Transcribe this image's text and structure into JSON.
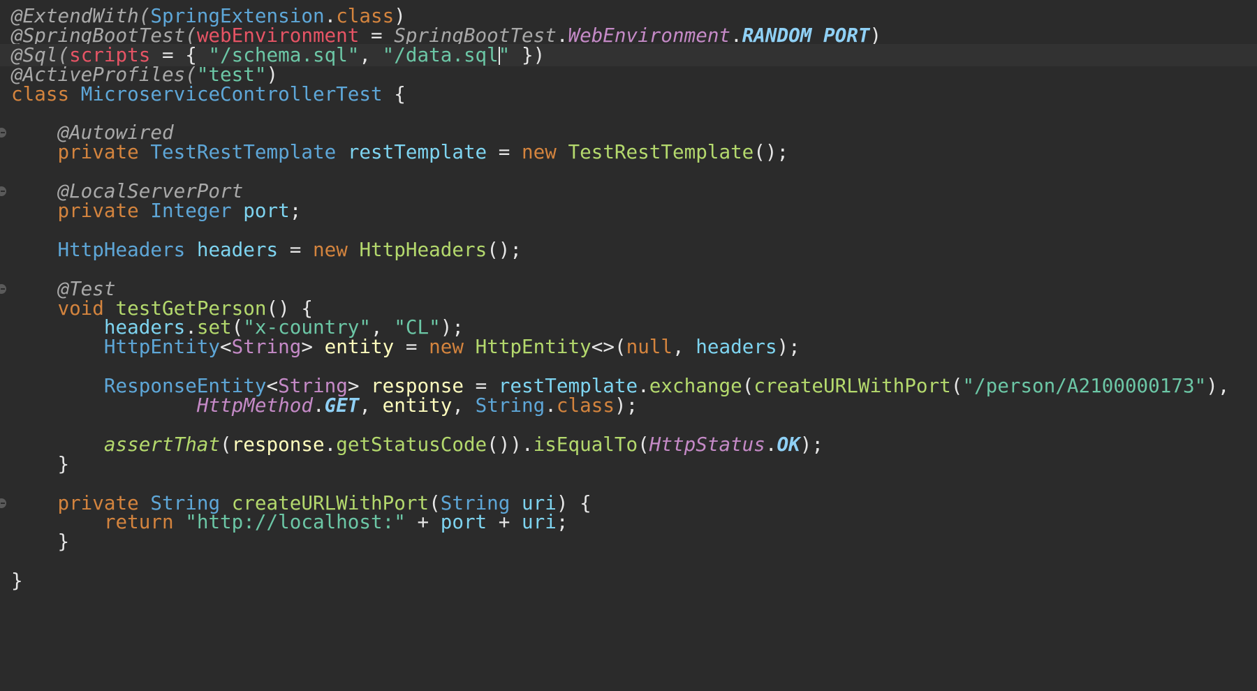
{
  "editor": {
    "language": "java",
    "current_line": 3,
    "theme": {
      "background": "#2b2b2b",
      "current_line_background": "#323232",
      "annotation": "#a9a9a9",
      "keyword": "#d4843e",
      "type": "#5ea7d8",
      "field": "#7ed4f0",
      "variable": "#fffdbe",
      "method": "#b4d96d",
      "string": "#6cc7a6",
      "param_name": "#e65465",
      "enum_type": "#c58ac7",
      "constant": "#8fd0f5",
      "default_text": "#e6e6e6",
      "fold_marker": "#5a5a5a"
    },
    "lines": [
      {
        "n": 1,
        "tokens": [
          [
            "@ExtendWith(",
            "annotation",
            "i"
          ],
          [
            "SpringExtension",
            "type"
          ],
          [
            ".",
            "default_text"
          ],
          [
            "class",
            "keyword"
          ],
          [
            ")",
            "default_text"
          ]
        ]
      },
      {
        "n": 2,
        "tokens": [
          [
            "@SpringBootTest(",
            "annotation",
            "i"
          ],
          [
            "webEnvironment",
            "param_name"
          ],
          [
            " = ",
            "default_text"
          ],
          [
            "SpringBootTest",
            "annotation",
            "i"
          ],
          [
            ".",
            "default_text"
          ],
          [
            "WebEnvironment",
            "enum_type",
            "i"
          ],
          [
            ".",
            "default_text"
          ],
          [
            "RANDOM_PORT",
            "constant",
            "ib"
          ],
          [
            ")",
            "default_text"
          ]
        ]
      },
      {
        "n": 3,
        "current": true,
        "tokens": [
          [
            "@Sql(",
            "annotation",
            "i"
          ],
          [
            "scripts",
            "param_name"
          ],
          [
            " = { ",
            "default_text"
          ],
          [
            "\"/schema.sql\"",
            "string"
          ],
          [
            ", ",
            "default_text"
          ],
          [
            "\"/data.sql",
            "string"
          ],
          [
            "|caret|",
            "caret"
          ],
          [
            "\"",
            "string"
          ],
          [
            " })",
            "default_text"
          ]
        ]
      },
      {
        "n": 4,
        "tokens": [
          [
            "@ActiveProfiles(",
            "annotation",
            "i"
          ],
          [
            "\"test\"",
            "string"
          ],
          [
            ")",
            "default_text"
          ]
        ]
      },
      {
        "n": 5,
        "tokens": [
          [
            "class",
            "keyword"
          ],
          [
            " ",
            "default_text"
          ],
          [
            "MicroserviceControllerTest",
            "type"
          ],
          [
            " {",
            "default_text"
          ]
        ]
      },
      {
        "n": 6,
        "tokens": []
      },
      {
        "n": 7,
        "fold": true,
        "tokens": [
          [
            "    ",
            "default_text"
          ],
          [
            "@Autowired",
            "annotation",
            "i"
          ]
        ]
      },
      {
        "n": 8,
        "tokens": [
          [
            "    ",
            "default_text"
          ],
          [
            "private",
            "keyword"
          ],
          [
            " ",
            "default_text"
          ],
          [
            "TestRestTemplate",
            "type"
          ],
          [
            " ",
            "default_text"
          ],
          [
            "restTemplate",
            "field"
          ],
          [
            " = ",
            "default_text"
          ],
          [
            "new",
            "keyword"
          ],
          [
            " ",
            "default_text"
          ],
          [
            "TestRestTemplate",
            "method"
          ],
          [
            "();",
            "default_text"
          ]
        ]
      },
      {
        "n": 9,
        "tokens": []
      },
      {
        "n": 10,
        "fold": true,
        "tokens": [
          [
            "    ",
            "default_text"
          ],
          [
            "@LocalServerPort",
            "annotation",
            "i"
          ]
        ]
      },
      {
        "n": 11,
        "tokens": [
          [
            "    ",
            "default_text"
          ],
          [
            "private",
            "keyword"
          ],
          [
            " ",
            "default_text"
          ],
          [
            "Integer",
            "type"
          ],
          [
            " ",
            "default_text"
          ],
          [
            "port",
            "field"
          ],
          [
            ";",
            "default_text"
          ]
        ]
      },
      {
        "n": 12,
        "tokens": []
      },
      {
        "n": 13,
        "tokens": [
          [
            "    ",
            "default_text"
          ],
          [
            "HttpHeaders",
            "type"
          ],
          [
            " ",
            "default_text"
          ],
          [
            "headers",
            "field"
          ],
          [
            " = ",
            "default_text"
          ],
          [
            "new",
            "keyword"
          ],
          [
            " ",
            "default_text"
          ],
          [
            "HttpHeaders",
            "method"
          ],
          [
            "();",
            "default_text"
          ]
        ]
      },
      {
        "n": 14,
        "tokens": []
      },
      {
        "n": 15,
        "fold": true,
        "tokens": [
          [
            "    ",
            "default_text"
          ],
          [
            "@Test",
            "annotation",
            "i"
          ]
        ]
      },
      {
        "n": 16,
        "tokens": [
          [
            "    ",
            "default_text"
          ],
          [
            "void",
            "keyword"
          ],
          [
            " ",
            "default_text"
          ],
          [
            "testGetPerson",
            "method"
          ],
          [
            "() {",
            "default_text"
          ]
        ]
      },
      {
        "n": 17,
        "tokens": [
          [
            "        ",
            "default_text"
          ],
          [
            "headers",
            "field"
          ],
          [
            ".",
            "default_text"
          ],
          [
            "set",
            "method"
          ],
          [
            "(",
            "default_text"
          ],
          [
            "\"x-country\"",
            "string"
          ],
          [
            ", ",
            "default_text"
          ],
          [
            "\"CL\"",
            "string"
          ],
          [
            ");",
            "default_text"
          ]
        ]
      },
      {
        "n": 18,
        "tokens": [
          [
            "        ",
            "default_text"
          ],
          [
            "HttpEntity",
            "type"
          ],
          [
            "<",
            "default_text"
          ],
          [
            "String",
            "enum_type"
          ],
          [
            "> ",
            "default_text"
          ],
          [
            "entity",
            "variable"
          ],
          [
            " = ",
            "default_text"
          ],
          [
            "new",
            "keyword"
          ],
          [
            " ",
            "default_text"
          ],
          [
            "HttpEntity",
            "method"
          ],
          [
            "<>(",
            "default_text"
          ],
          [
            "null",
            "keyword"
          ],
          [
            ", ",
            "default_text"
          ],
          [
            "headers",
            "field"
          ],
          [
            ");",
            "default_text"
          ]
        ]
      },
      {
        "n": 19,
        "tokens": []
      },
      {
        "n": 20,
        "tokens": [
          [
            "        ",
            "default_text"
          ],
          [
            "ResponseEntity",
            "type"
          ],
          [
            "<",
            "default_text"
          ],
          [
            "String",
            "enum_type"
          ],
          [
            "> ",
            "default_text"
          ],
          [
            "response",
            "variable"
          ],
          [
            " = ",
            "default_text"
          ],
          [
            "restTemplate",
            "field"
          ],
          [
            ".",
            "default_text"
          ],
          [
            "exchange",
            "method"
          ],
          [
            "(",
            "default_text"
          ],
          [
            "createURLWithPort",
            "method"
          ],
          [
            "(",
            "default_text"
          ],
          [
            "\"/person/A2100000173\"",
            "string"
          ],
          [
            "),",
            "default_text"
          ]
        ]
      },
      {
        "n": 21,
        "tokens": [
          [
            "                ",
            "default_text"
          ],
          [
            "HttpMethod",
            "enum_type",
            "i"
          ],
          [
            ".",
            "default_text"
          ],
          [
            "GET",
            "constant",
            "ib"
          ],
          [
            ", ",
            "default_text"
          ],
          [
            "entity",
            "variable"
          ],
          [
            ", ",
            "default_text"
          ],
          [
            "String",
            "type"
          ],
          [
            ".",
            "default_text"
          ],
          [
            "class",
            "keyword"
          ],
          [
            ");",
            "default_text"
          ]
        ]
      },
      {
        "n": 22,
        "tokens": []
      },
      {
        "n": 23,
        "tokens": [
          [
            "        ",
            "default_text"
          ],
          [
            "assertThat",
            "method",
            "i"
          ],
          [
            "(",
            "default_text"
          ],
          [
            "response",
            "variable"
          ],
          [
            ".",
            "default_text"
          ],
          [
            "getStatusCode",
            "method"
          ],
          [
            "()).",
            "default_text"
          ],
          [
            "isEqualTo",
            "method"
          ],
          [
            "(",
            "default_text"
          ],
          [
            "HttpStatus",
            "enum_type",
            "i"
          ],
          [
            ".",
            "default_text"
          ],
          [
            "OK",
            "constant",
            "ib"
          ],
          [
            ");",
            "default_text"
          ]
        ]
      },
      {
        "n": 24,
        "tokens": [
          [
            "    ",
            "default_text"
          ],
          [
            "}",
            "default_text"
          ]
        ]
      },
      {
        "n": 25,
        "tokens": []
      },
      {
        "n": 26,
        "fold": true,
        "tokens": [
          [
            "    ",
            "default_text"
          ],
          [
            "private",
            "keyword"
          ],
          [
            " ",
            "default_text"
          ],
          [
            "String",
            "type"
          ],
          [
            " ",
            "default_text"
          ],
          [
            "createURLWithPort",
            "method"
          ],
          [
            "(",
            "default_text"
          ],
          [
            "String",
            "type"
          ],
          [
            " ",
            "default_text"
          ],
          [
            "uri",
            "field"
          ],
          [
            ") {",
            "default_text"
          ]
        ]
      },
      {
        "n": 27,
        "tokens": [
          [
            "        ",
            "default_text"
          ],
          [
            "return",
            "keyword"
          ],
          [
            " ",
            "default_text"
          ],
          [
            "\"http://localhost:\"",
            "string"
          ],
          [
            " + ",
            "default_text"
          ],
          [
            "port",
            "field"
          ],
          [
            " + ",
            "default_text"
          ],
          [
            "uri",
            "field"
          ],
          [
            ";",
            "default_text"
          ]
        ]
      },
      {
        "n": 28,
        "tokens": [
          [
            "    ",
            "default_text"
          ],
          [
            "}",
            "default_text"
          ]
        ]
      },
      {
        "n": 29,
        "tokens": []
      },
      {
        "n": 30,
        "tokens": [
          [
            "}",
            "default_text"
          ]
        ]
      }
    ]
  }
}
